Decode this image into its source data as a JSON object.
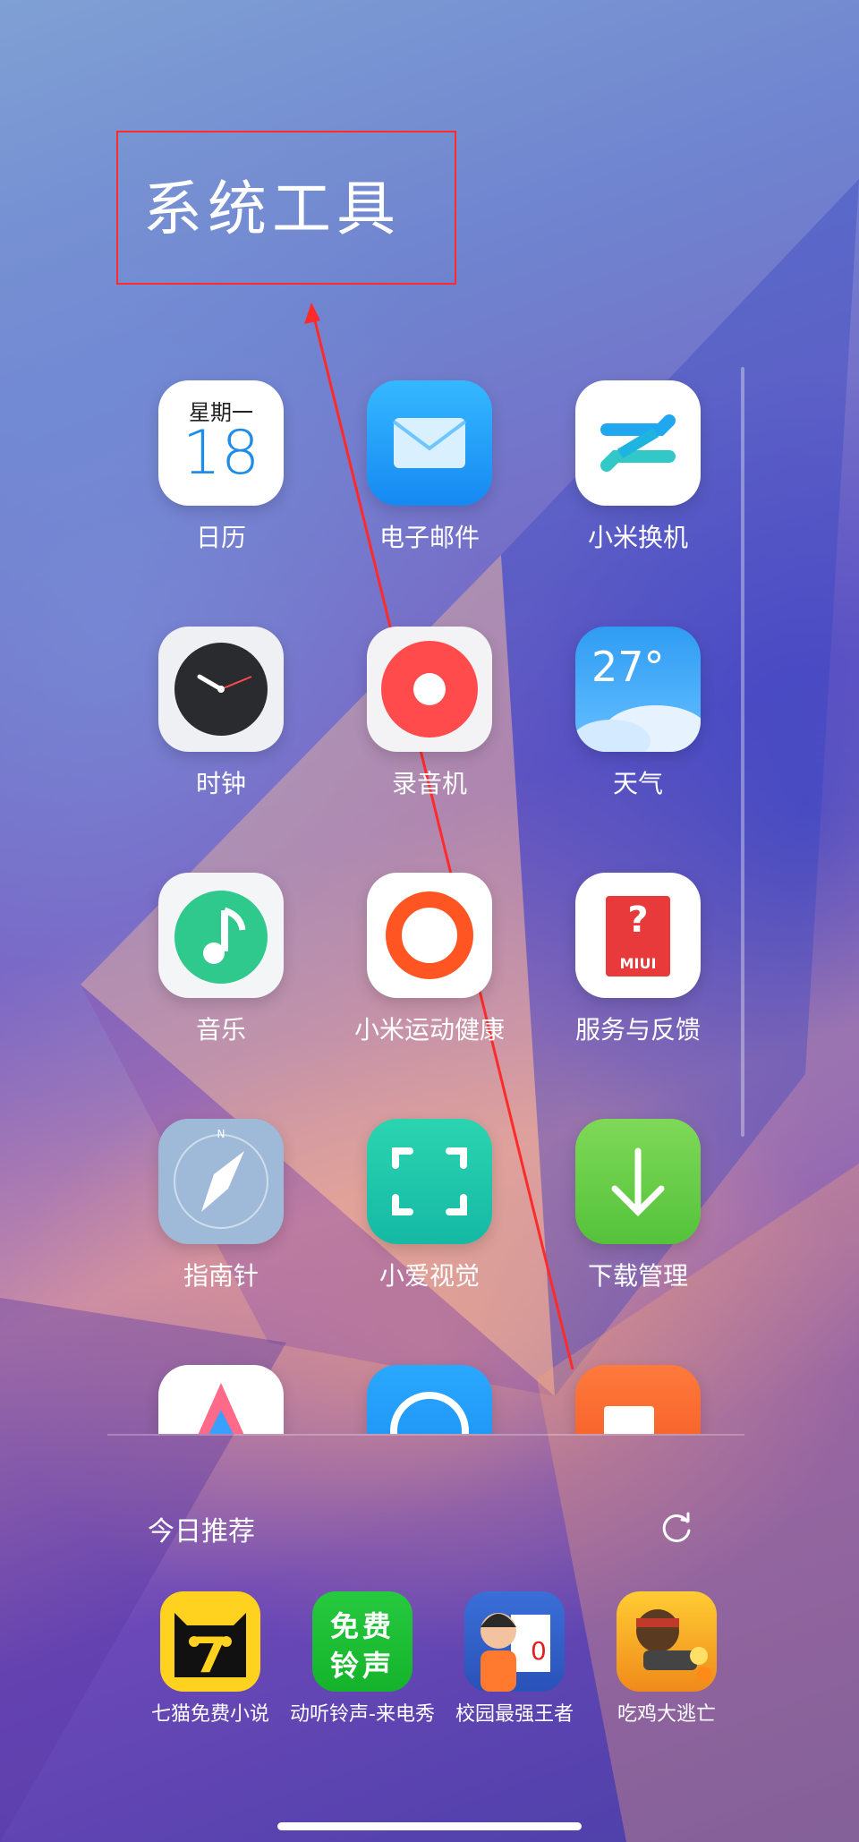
{
  "folder": {
    "title": "系统工具"
  },
  "apps": [
    {
      "name": "日历",
      "icon": "calendar-icon",
      "weekday": "星期一",
      "day": "18"
    },
    {
      "name": "电子邮件",
      "icon": "email-icon"
    },
    {
      "name": "小米换机",
      "icon": "phone-transfer-icon"
    },
    {
      "name": "时钟",
      "icon": "clock-icon"
    },
    {
      "name": "录音机",
      "icon": "recorder-icon"
    },
    {
      "name": "天气",
      "icon": "weather-icon",
      "temp": "27°"
    },
    {
      "name": "音乐",
      "icon": "music-icon"
    },
    {
      "name": "小米运动健康",
      "icon": "fitness-ring-icon"
    },
    {
      "name": "服务与反馈",
      "icon": "feedback-icon",
      "badge": "MIUI",
      "mark": "?"
    },
    {
      "name": "指南针",
      "icon": "compass-icon",
      "north": "N"
    },
    {
      "name": "小爱视觉",
      "icon": "scan-icon"
    },
    {
      "name": "下载管理",
      "icon": "download-icon"
    }
  ],
  "recommend": {
    "title": "今日推荐",
    "apps": [
      {
        "name": "七猫免费小说",
        "icon": "cat-novel-icon",
        "mark": "7"
      },
      {
        "name": "动听铃声-来电秀",
        "icon": "ringtone-icon",
        "line1": "免费",
        "line2": "铃声"
      },
      {
        "name": "校园最强王者",
        "icon": "campus-game-icon"
      },
      {
        "name": "吃鸡大逃亡",
        "icon": "shooter-game-icon"
      }
    ]
  }
}
